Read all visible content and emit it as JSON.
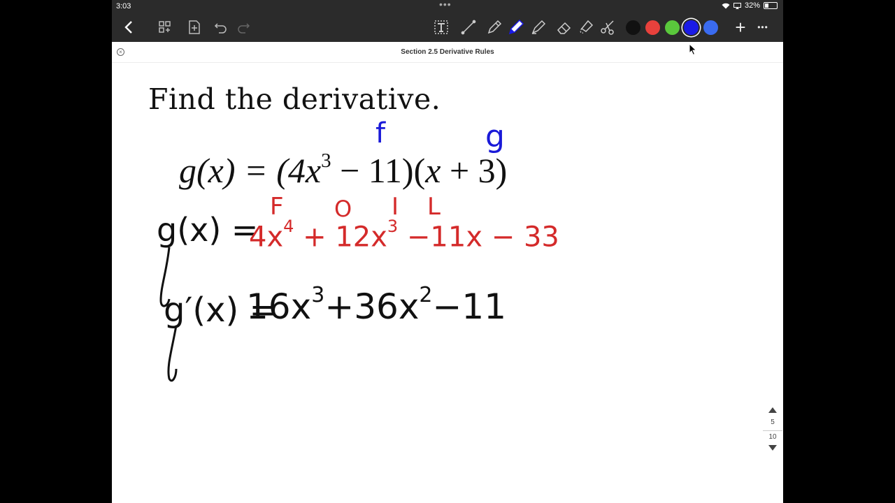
{
  "status": {
    "time": "3:03",
    "battery": "32%",
    "battery_level": 0.32
  },
  "toolbar": {
    "back": "chevron-left-icon",
    "tools": [
      "thumbnails-icon",
      "add-page-icon",
      "undo-icon",
      "redo-icon",
      "text-tool-icon",
      "line-tool-icon",
      "pen-icon",
      "pencil-icon",
      "highlighter-icon",
      "eraser-icon",
      "lasso-icon",
      "scissors-icon"
    ],
    "colors": [
      "#111111",
      "#e8413c",
      "#5ac83c",
      "#1a1ae6",
      "#3a6bf0"
    ],
    "selected_color": "#1a1ae6",
    "add": "+",
    "more": "•••"
  },
  "document": {
    "title": "Section 2.5 Derivative Rules"
  },
  "page": {
    "heading": "Find the derivative.",
    "equation": {
      "lhs": "g(x) = (4x",
      "exp1": "3",
      "mid": " − 11)(",
      "var2": "x",
      "tail": " + 3)"
    },
    "annotations": {
      "f_label": "f",
      "g_label": "g",
      "foil": [
        "F",
        "O",
        "I",
        "L"
      ],
      "gx_label": "g(x) =",
      "expanded": {
        "t1": "4x",
        "e1": "4",
        "t2": " + 12x",
        "e2": "3",
        "t3": " −11x",
        "t4": " − 33"
      },
      "deriv_label": "g′(x) =",
      "derivative": {
        "t1": "16x",
        "e1": "3",
        "t2": "+36x",
        "e2": "2",
        "t3": "−11"
      }
    }
  },
  "pagination": {
    "current": "5",
    "total": "10"
  }
}
